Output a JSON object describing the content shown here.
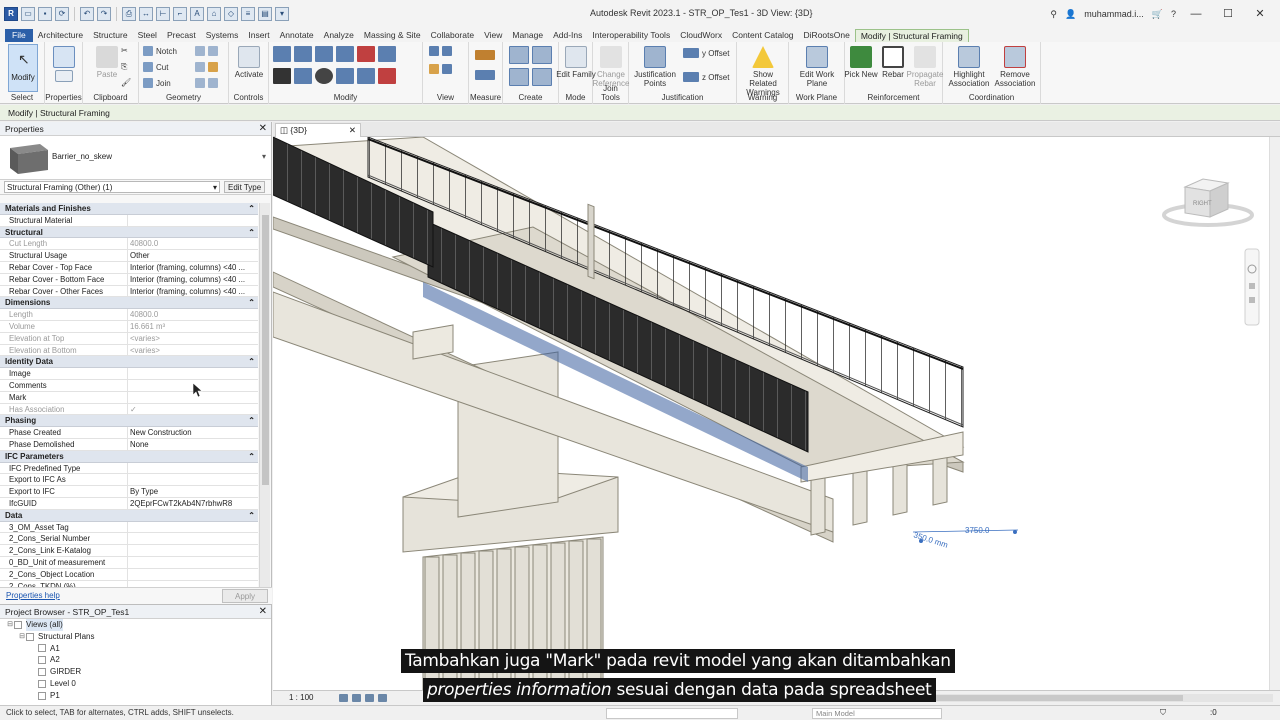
{
  "app": {
    "title": "Autodesk Revit 2023.1 - STR_OP_Tes1 - 3D View: {3D}",
    "user": "muhammad.i...",
    "help": "?"
  },
  "qat": {
    "revit_logo": "R"
  },
  "tabs": [
    "File",
    "Architecture",
    "Structure",
    "Steel",
    "Precast",
    "Systems",
    "Insert",
    "Annotate",
    "Analyze",
    "Massing & Site",
    "Collaborate",
    "View",
    "Manage",
    "Add-Ins",
    "Interoperability Tools",
    "CloudWorx",
    "Content Catalog",
    "DiRootsOne",
    "Modify | Structural Framing"
  ],
  "ribbon": {
    "select": {
      "modify": "Modify",
      "label": "Select"
    },
    "properties": {
      "label": "Properties"
    },
    "clipboard": {
      "paste": "Paste",
      "label": "Clipboard"
    },
    "geometry": {
      "notch": "Notch",
      "cut": "Cut",
      "join": "Join",
      "label": "Geometry"
    },
    "controls": {
      "activate": "Activate",
      "label": "Controls"
    },
    "modify": {
      "label": "Modify"
    },
    "view": {
      "label": "View"
    },
    "measure": {
      "label": "Measure"
    },
    "create": {
      "label": "Create"
    },
    "mode": {
      "edit_family": "Edit Family",
      "label": "Mode"
    },
    "join_tools": {
      "change_reference": "Change Reference",
      "label": "Join Tools"
    },
    "justification": {
      "points": "Justification Points",
      "y_offset": "y Offset",
      "z_offset": "z Offset",
      "label": "Justification"
    },
    "warning": {
      "show_related": "Show Related Warnings",
      "label": "Warning"
    },
    "work_plane": {
      "edit": "Edit Work Plane",
      "label": "Work Plane"
    },
    "reinforcement": {
      "pick_new": "Pick New",
      "rebar": "Rebar",
      "propagate": "Propagate Rebar",
      "label": "Reinforcement"
    },
    "coordination": {
      "highlight": "Highlight Association",
      "remove": "Remove Association",
      "label": "Coordination"
    }
  },
  "options_bar": "Modify | Structural Framing",
  "properties": {
    "header": "Properties",
    "type_name": "Barrier_no_skew",
    "instance_filter": "Structural Framing (Other) (1)",
    "edit_type": "Edit Type",
    "groups": [
      {
        "name": "Materials and Finishes",
        "rows": [
          {
            "k": "Structural Material",
            "v": "",
            "ro": false
          }
        ]
      },
      {
        "name": "Structural",
        "rows": [
          {
            "k": "Cut Length",
            "v": "40800.0",
            "ro": true
          },
          {
            "k": "Structural Usage",
            "v": "Other",
            "ro": false
          },
          {
            "k": "Rebar Cover - Top Face",
            "v": "Interior (framing, columns) <40 ...",
            "ro": false
          },
          {
            "k": "Rebar Cover - Bottom Face",
            "v": "Interior (framing, columns) <40 ...",
            "ro": false
          },
          {
            "k": "Rebar Cover - Other Faces",
            "v": "Interior (framing, columns) <40 ...",
            "ro": false
          }
        ]
      },
      {
        "name": "Dimensions",
        "rows": [
          {
            "k": "Length",
            "v": "40800.0",
            "ro": true
          },
          {
            "k": "Volume",
            "v": "16.661 m³",
            "ro": true
          },
          {
            "k": "Elevation at Top",
            "v": "<varies>",
            "ro": true
          },
          {
            "k": "Elevation at Bottom",
            "v": "<varies>",
            "ro": true
          }
        ]
      },
      {
        "name": "Identity Data",
        "rows": [
          {
            "k": "Image",
            "v": "",
            "ro": false
          },
          {
            "k": "Comments",
            "v": "",
            "ro": false
          },
          {
            "k": "Mark",
            "v": "",
            "ro": false
          },
          {
            "k": "Has Association",
            "v": "✓",
            "ro": true
          }
        ]
      },
      {
        "name": "Phasing",
        "rows": [
          {
            "k": "Phase Created",
            "v": "New Construction",
            "ro": false
          },
          {
            "k": "Phase Demolished",
            "v": "None",
            "ro": false
          }
        ]
      },
      {
        "name": "IFC Parameters",
        "rows": [
          {
            "k": "IFC Predefined Type",
            "v": "",
            "ro": false
          },
          {
            "k": "Export to IFC As",
            "v": "",
            "ro": false
          },
          {
            "k": "Export to IFC",
            "v": "By Type",
            "ro": false
          },
          {
            "k": "IfcGUID",
            "v": "2QEprFCwT2kAb4N7rbhwR8",
            "ro": false
          }
        ]
      },
      {
        "name": "Data",
        "rows": [
          {
            "k": "3_OM_Asset Tag",
            "v": "",
            "ro": false
          },
          {
            "k": "2_Cons_Serial Number",
            "v": "",
            "ro": false
          },
          {
            "k": "2_Cons_Link E-Katalog",
            "v": "",
            "ro": false
          },
          {
            "k": "0_BD_Unit of measurement",
            "v": "",
            "ro": false
          },
          {
            "k": "2_Cons_Object Location",
            "v": "",
            "ro": false
          },
          {
            "k": "2_Cons_TKDN (%)",
            "v": "",
            "ro": false
          }
        ]
      }
    ],
    "help_link": "Properties help",
    "apply": "Apply"
  },
  "project_browser": {
    "header": "Project Browser - STR_OP_Tes1",
    "items": [
      {
        "label": "Views (all)",
        "level": 0,
        "toggle": "⊟",
        "sel": true
      },
      {
        "label": "Structural Plans",
        "level": 1,
        "toggle": "⊟",
        "sel": false
      },
      {
        "label": "A1",
        "level": 2,
        "toggle": "",
        "sel": false
      },
      {
        "label": "A2",
        "level": 2,
        "toggle": "",
        "sel": false
      },
      {
        "label": "GIRDER",
        "level": 2,
        "toggle": "",
        "sel": false
      },
      {
        "label": "Level 0",
        "level": 2,
        "toggle": "",
        "sel": false
      },
      {
        "label": "P1",
        "level": 2,
        "toggle": "",
        "sel": false
      }
    ]
  },
  "view": {
    "tab_label": "{3D}",
    "viewcube_face": "RIGHT",
    "dim_label_1": "350.0 mm",
    "dim_label_2": "3750.0"
  },
  "view_control": {
    "scale": "1 : 100"
  },
  "status": {
    "hint": "Click to select, TAB for alternates, CTRL adds, SHIFT unselects.",
    "design_option": "Main Model",
    "filter_count": ":0"
  },
  "subtitle": {
    "line1": "Tambahkan juga \"Mark\" pada revit model yang akan ditambahkan",
    "line2_italic": "properties information",
    "line2_rest": " sesuai dengan data pada spreadsheet"
  }
}
